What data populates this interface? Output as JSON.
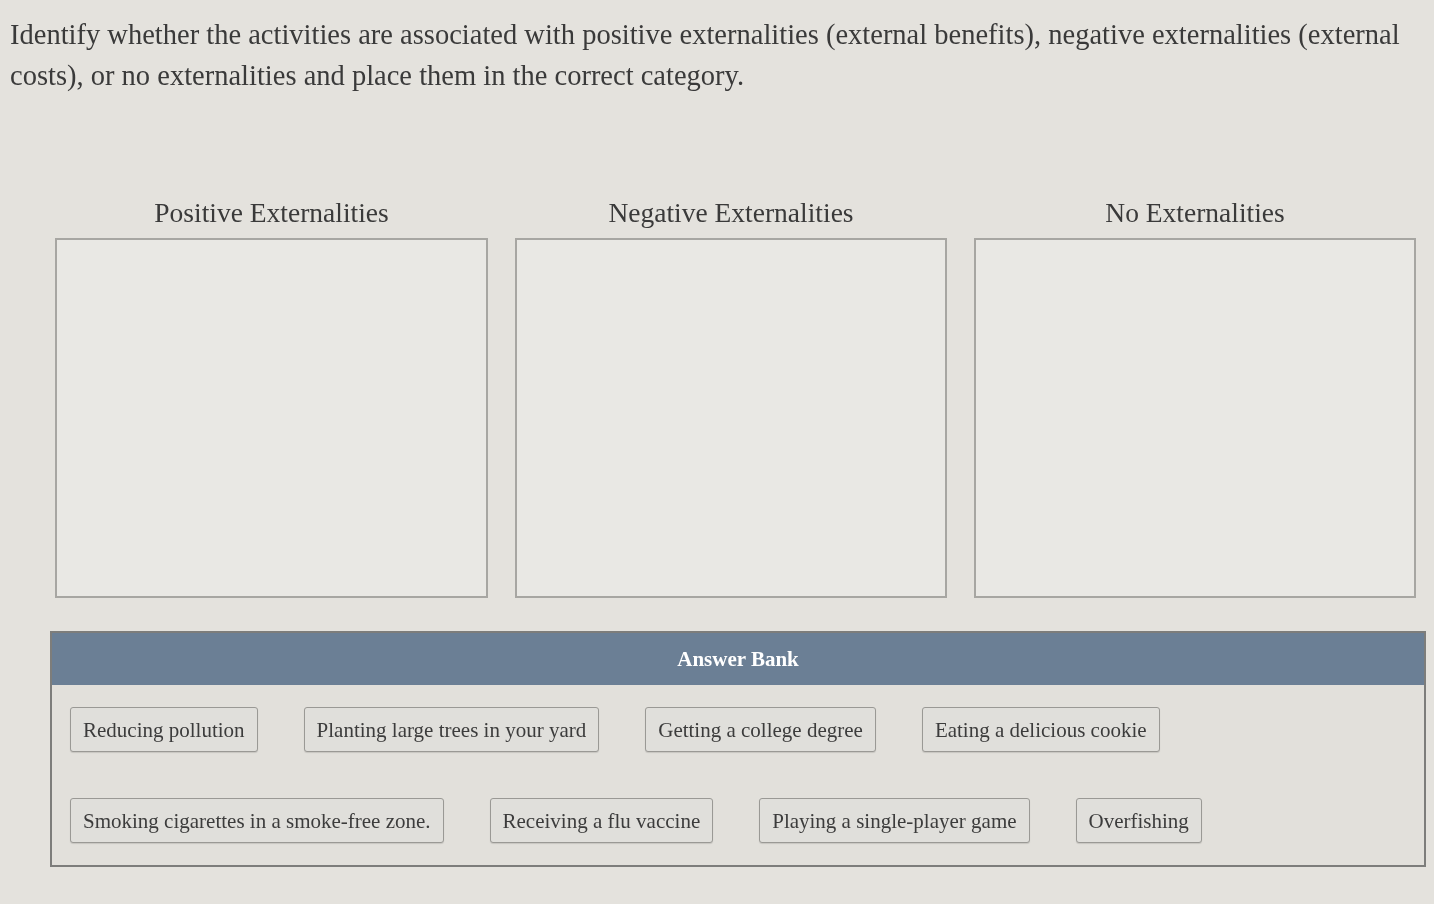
{
  "prompt": "Identify whether the activities are associated with positive externalities (external benefits), negative externalities (external costs), or no externalities and place them in the correct category.",
  "categories": [
    {
      "title": "Positive Externalities"
    },
    {
      "title": "Negative Externalities"
    },
    {
      "title": "No Externalities"
    }
  ],
  "answer_bank": {
    "title": "Answer Bank",
    "items": [
      "Reducing pollution",
      "Planting large trees in your yard",
      "Getting a college degree",
      "Eating a delicious cookie",
      "Smoking cigarettes in a smoke-free zone.",
      "Receiving a flu vaccine",
      "Playing a single-player game",
      "Overfishing"
    ]
  }
}
